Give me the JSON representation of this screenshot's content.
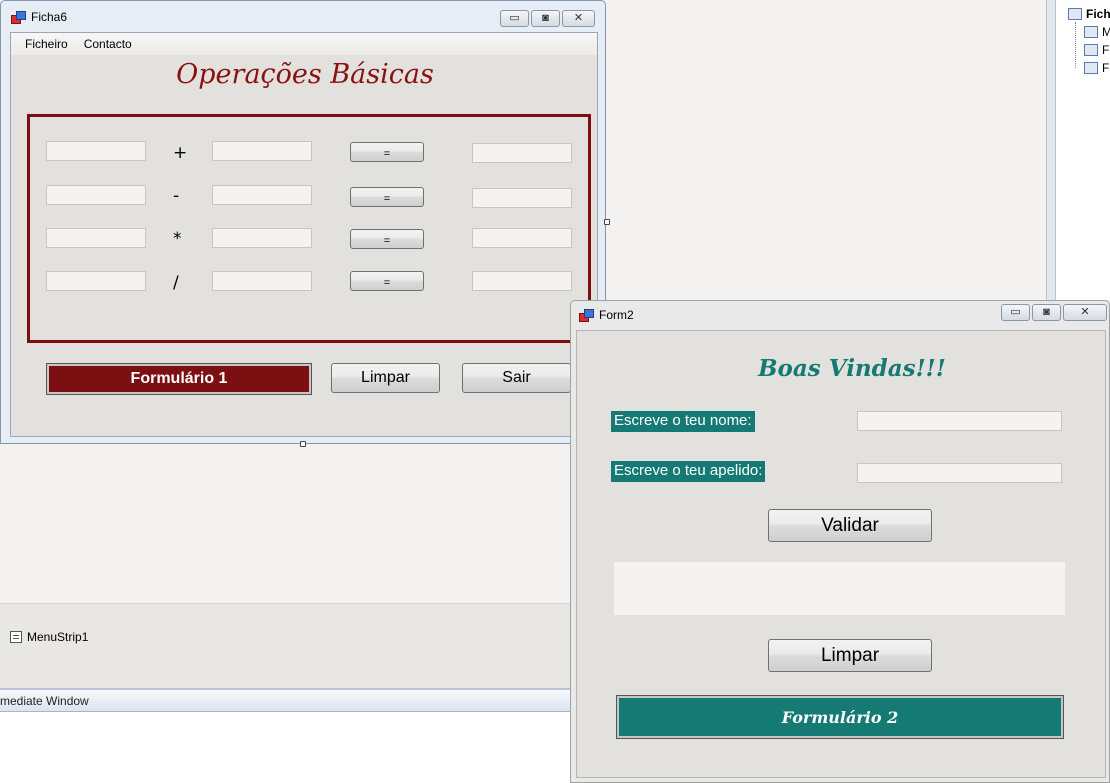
{
  "ide": {
    "solution_root": "Fich",
    "solution_items": [
      "M",
      "F",
      "F"
    ],
    "tray_component": "MenuStrip1",
    "bottom_panel_title": "mediate Window"
  },
  "form1": {
    "title": "Ficha6",
    "menu": [
      "Ficheiro",
      "Contacto"
    ],
    "heading": "Operações Básicas",
    "operators": [
      "+",
      "-",
      "*",
      "/"
    ],
    "equals_label": "=",
    "buttons": {
      "form": "Formulário 1",
      "clear": "Limpar",
      "exit": "Sair"
    }
  },
  "form2": {
    "title": "Form2",
    "heading": "Boas Vindas!!!",
    "name_label": "Escreve o teu nome:",
    "surname_label": "Escreve o teu apelido:",
    "validate_button": "Validar",
    "clear_button": "Limpar",
    "form_button": "Formulário 2"
  },
  "window_controls": {
    "minimize": "▭",
    "maximize": "◙",
    "close": "✕"
  },
  "colors": {
    "form1_accent": "#7b0f12",
    "form2_accent": "#147a73"
  }
}
